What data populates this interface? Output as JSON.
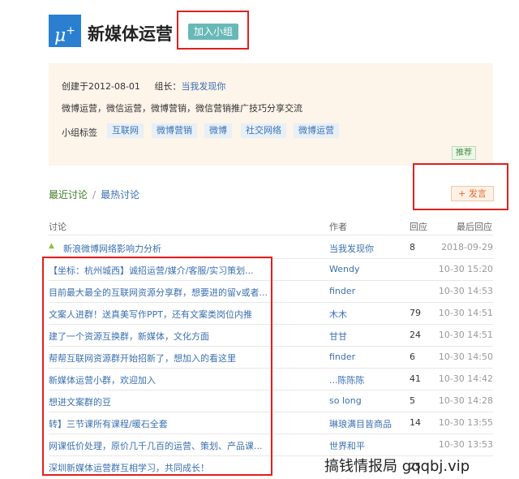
{
  "header": {
    "logo_text": "μ",
    "logo_sup": "+",
    "title": "新媒体运营",
    "join_label": "加入小组"
  },
  "info": {
    "created": "创建于2012-08-01",
    "owner_label": "组长：",
    "owner_name": "当我发现你",
    "description": "微博运营，微信运营，微博营销，微信营销推广技巧分享交流",
    "tags_label": "小组标签",
    "tags": [
      "互联网",
      "微博营销",
      "微博",
      "社交网络",
      "微博运营"
    ],
    "recommend_label": "推荐"
  },
  "tabs": {
    "recent": "最近讨论",
    "separator": "/",
    "hot": "最热讨论",
    "post_label": "+ 发言"
  },
  "table": {
    "headers": {
      "topic": "讨论",
      "author": "作者",
      "replies": "回应",
      "last": "最后回应"
    },
    "rows": [
      {
        "title": "新浪微博网络影响力分析",
        "author": "当我发现你",
        "replies": "8",
        "last": "2018-09-29",
        "pinned": true
      },
      {
        "title": "【坐标：杭州城西】诚招运营/媒介/客服/实习策划...",
        "author": "Wendy",
        "replies": "",
        "last": "10-30 15:20"
      },
      {
        "title": "目前最大最全的互联网资源分享群，想要进的留v或者...",
        "author": "finder",
        "replies": "",
        "last": "10-30 14:53"
      },
      {
        "title": "文案人进群！送真美写作PPT，还有文案类岗位内推",
        "author": "木木",
        "replies": "79",
        "last": "10-30 14:51"
      },
      {
        "title": "建了一个资源互换群，新媒体，文化方面",
        "author": "甘甘",
        "replies": "24",
        "last": "10-30 14:51"
      },
      {
        "title": "帮帮互联网资源群开始招新了，想加入的看这里",
        "author": "finder",
        "replies": "6",
        "last": "10-30 14:50"
      },
      {
        "title": "新媒体运营小群，欢迎加入",
        "author": "...陈陈陈",
        "replies": "41",
        "last": "10-30 14:42"
      },
      {
        "title": "想进文案群的豆",
        "author": "so long",
        "replies": "5",
        "last": "10-30 14:28"
      },
      {
        "title": "转】三节课所有课程/暖石全套",
        "author": "琳琅满目皆商品",
        "replies": "14",
        "last": "10-30 13:55"
      },
      {
        "title": "网课低价处理，原价几千几百的运营、策划、产品课...",
        "author": "世界和平",
        "replies": "",
        "last": "10-30 13:53"
      },
      {
        "title": "深圳新媒体运营群互相学习，共同成长！",
        "author": "",
        "replies": "25",
        "last": ""
      }
    ]
  },
  "watermark": "搞钱情报局 gqqbj.vip"
}
